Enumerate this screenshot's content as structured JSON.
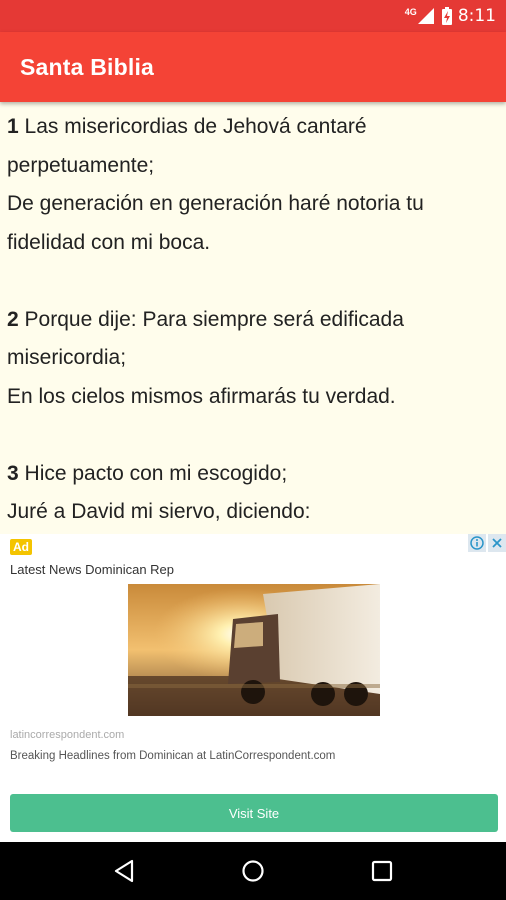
{
  "status_bar": {
    "network_label": "4G",
    "time": "8:11",
    "icons": [
      "signal-icon",
      "battery-icon"
    ]
  },
  "app_bar": {
    "title": "Santa Biblia"
  },
  "verses": [
    {
      "number": "1",
      "text": "Las misericordias de Jehová cantaré perpetuamente;\nDe generación en generación haré notoria tu fidelidad con mi boca."
    },
    {
      "number": "2",
      "text": "Porque dije: Para siempre será edificada misericordia;\nEn los cielos mismos afirmarás tu verdad."
    },
    {
      "number": "3",
      "text": "Hice pacto con mi escogido;\nJuré a David mi siervo, diciendo:"
    }
  ],
  "ad": {
    "badge": "Ad",
    "headline": "Latest News Dominican Rep",
    "domain": "latincorrespondent.com",
    "description": "Breaking Headlines from Dominican at LatinCorrespondent.com",
    "button_label": "Visit Site",
    "icons": [
      "info-icon",
      "close-icon"
    ],
    "colors": {
      "badge": "#f4c400",
      "button": "#4cbf8f"
    }
  },
  "nav_bar": {
    "icons": [
      "back-icon",
      "home-icon",
      "recents-icon"
    ]
  },
  "colors": {
    "status_bar": "#e53935",
    "app_bar": "#f44336",
    "content_background": "#fffdec"
  }
}
